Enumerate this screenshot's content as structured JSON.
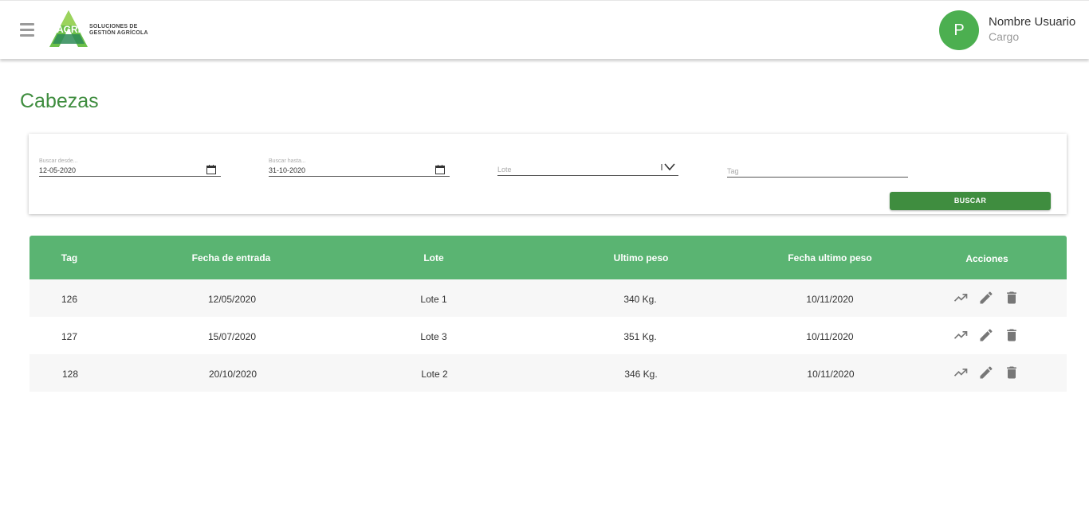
{
  "brand": {
    "logo_text": "AGRI",
    "tagline_line1": "SOLUCIONES DE",
    "tagline_line2": "GESTIÓN AGRÍCOLA"
  },
  "user": {
    "initial": "P",
    "name": "Nombre Usuario",
    "role": "Cargo"
  },
  "page": {
    "title": "Cabezas"
  },
  "filters": {
    "from_label": "Buscar desde...",
    "from_value": "12-05-2020",
    "to_label": "Buscar hasta...",
    "to_value": "31-10-2020",
    "lote_placeholder": "Lote",
    "tag_placeholder": "Tag",
    "search_button": "BUSCAR"
  },
  "table": {
    "columns": [
      "Tag",
      "Fecha de entrada",
      "Lote",
      "Ultimo peso",
      "Fecha ultimo peso",
      "Acciones"
    ],
    "rows": [
      {
        "tag": "126",
        "fecha_entrada": "12/05/2020",
        "lote": "Lote 1",
        "ultimo_peso": "340 Kg.",
        "fecha_ultimo_peso": "10/11/2020"
      },
      {
        "tag": "127",
        "fecha_entrada": "15/07/2020",
        "lote": "Lote 3",
        "ultimo_peso": "351 Kg.",
        "fecha_ultimo_peso": "10/11/2020"
      },
      {
        "tag": "128",
        "fecha_entrada": "20/10/2020",
        "lote": "Lote 2",
        "ultimo_peso": "346 Kg.",
        "fecha_ultimo_peso": "10/11/2020"
      }
    ],
    "action_icons": [
      "trending-up-icon",
      "edit-icon",
      "delete-icon"
    ]
  },
  "colors": {
    "brand_green": "#3f8d3f",
    "header_green": "#5ab472",
    "avatar_green": "#4caf50",
    "icon_gray": "#777777"
  }
}
